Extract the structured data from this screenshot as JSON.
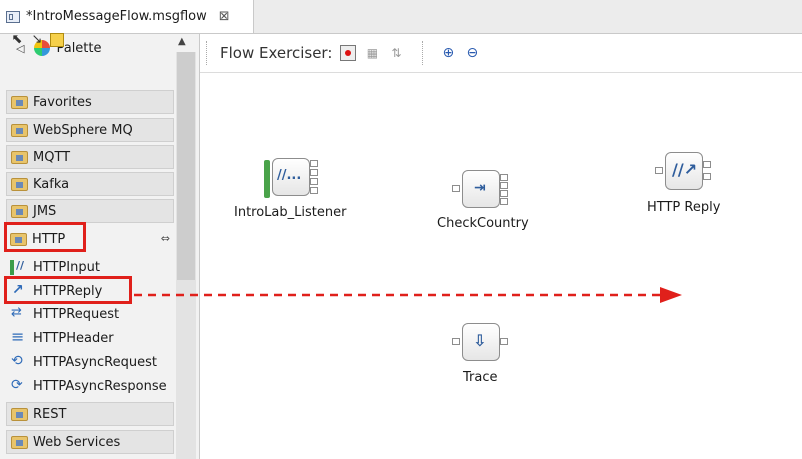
{
  "editor": {
    "tab_title": "*IntroMessageFlow.msgflow",
    "close": "⊠"
  },
  "palette": {
    "title": "Palette",
    "drawers_top": [
      {
        "label": "Favorites"
      },
      {
        "label": "WebSphere MQ"
      },
      {
        "label": "MQTT"
      },
      {
        "label": "Kafka"
      },
      {
        "label": "JMS"
      }
    ],
    "http_drawer": {
      "label": "HTTP"
    },
    "http_items": [
      {
        "label": "HTTPInput",
        "icon": "http-input-icon"
      },
      {
        "label": "HTTPReply",
        "icon": "http-reply-icon"
      },
      {
        "label": "HTTPRequest",
        "icon": "http-request-icon"
      },
      {
        "label": "HTTPHeader",
        "icon": "http-header-icon"
      },
      {
        "label": "HTTPAsyncRequest",
        "icon": "http-async-request-icon"
      },
      {
        "label": "HTTPAsyncResponse",
        "icon": "http-async-response-icon"
      }
    ],
    "drawers_bottom": [
      {
        "label": "REST"
      },
      {
        "label": "Web Services"
      }
    ]
  },
  "toolbar": {
    "flow_exerciser_label": "Flow Exerciser:"
  },
  "canvas": {
    "nodes": [
      {
        "label": "IntroLab_Listener"
      },
      {
        "label": "CheckCountry"
      },
      {
        "label": "HTTP Reply"
      },
      {
        "label": "Trace"
      }
    ]
  },
  "annotation_color": "#e0201b"
}
